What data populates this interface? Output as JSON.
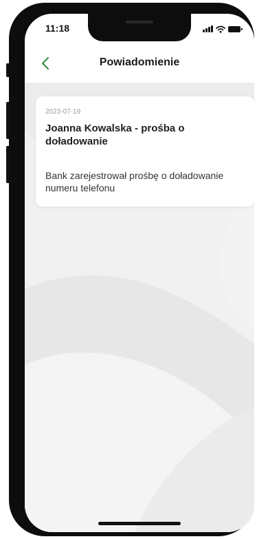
{
  "status_bar": {
    "time": "11:18",
    "icons": [
      "signal-icon",
      "wifi-icon",
      "battery-icon"
    ]
  },
  "header": {
    "title": "Powiadomienie",
    "back_icon": "chevron-left-icon",
    "accent_color": "#2e8b3e"
  },
  "notification": {
    "date": "2023-07-19",
    "title": "Joanna Kowalska - prośba o doładowanie",
    "body": "Bank zarejestrował prośbę o doładowanie numeru telefonu"
  }
}
